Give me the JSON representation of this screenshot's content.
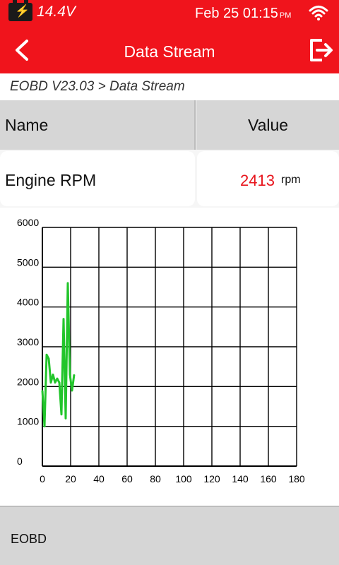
{
  "status_bar": {
    "voltage": "14.4V",
    "date": "Feb 25",
    "time": "01:15",
    "ampm": "PM",
    "icons": [
      "battery-icon",
      "wifi-icon"
    ]
  },
  "app_bar": {
    "title": "Data Stream",
    "icons": [
      "back-icon",
      "exit-icon"
    ]
  },
  "breadcrumb": "EOBD V23.03 > Data Stream",
  "table": {
    "columns": [
      "Name",
      "Value"
    ],
    "rows": [
      {
        "name": "Engine RPM",
        "value": "2413",
        "unit": "rpm"
      }
    ]
  },
  "chart_data": {
    "type": "line",
    "xlim": [
      0,
      180
    ],
    "ylim": [
      0,
      6000
    ],
    "xticks": [
      "0",
      "20",
      "40",
      "60",
      "80",
      "100",
      "120",
      "140",
      "160",
      "180"
    ],
    "yticks": [
      "0",
      "1000",
      "2000",
      "3000",
      "4000",
      "5000",
      "6000"
    ],
    "grid": true,
    "series": [
      {
        "color": "#22c52b",
        "x": [
          0,
          1.5,
          3,
          4.5,
          6,
          7.5,
          9,
          10.5,
          12,
          13.5,
          15,
          16.5,
          18,
          19.5,
          21,
          22.5
        ],
        "y": [
          1900,
          1000,
          2800,
          2700,
          2100,
          2300,
          2100,
          2200,
          2100,
          1300,
          3700,
          1200,
          4600,
          2300,
          1900,
          2300
        ]
      }
    ]
  },
  "footer": {
    "label": "EOBD"
  },
  "colors": {
    "accent": "#f0141c",
    "value_text": "#e8141c",
    "series_line": "#22c52b"
  }
}
